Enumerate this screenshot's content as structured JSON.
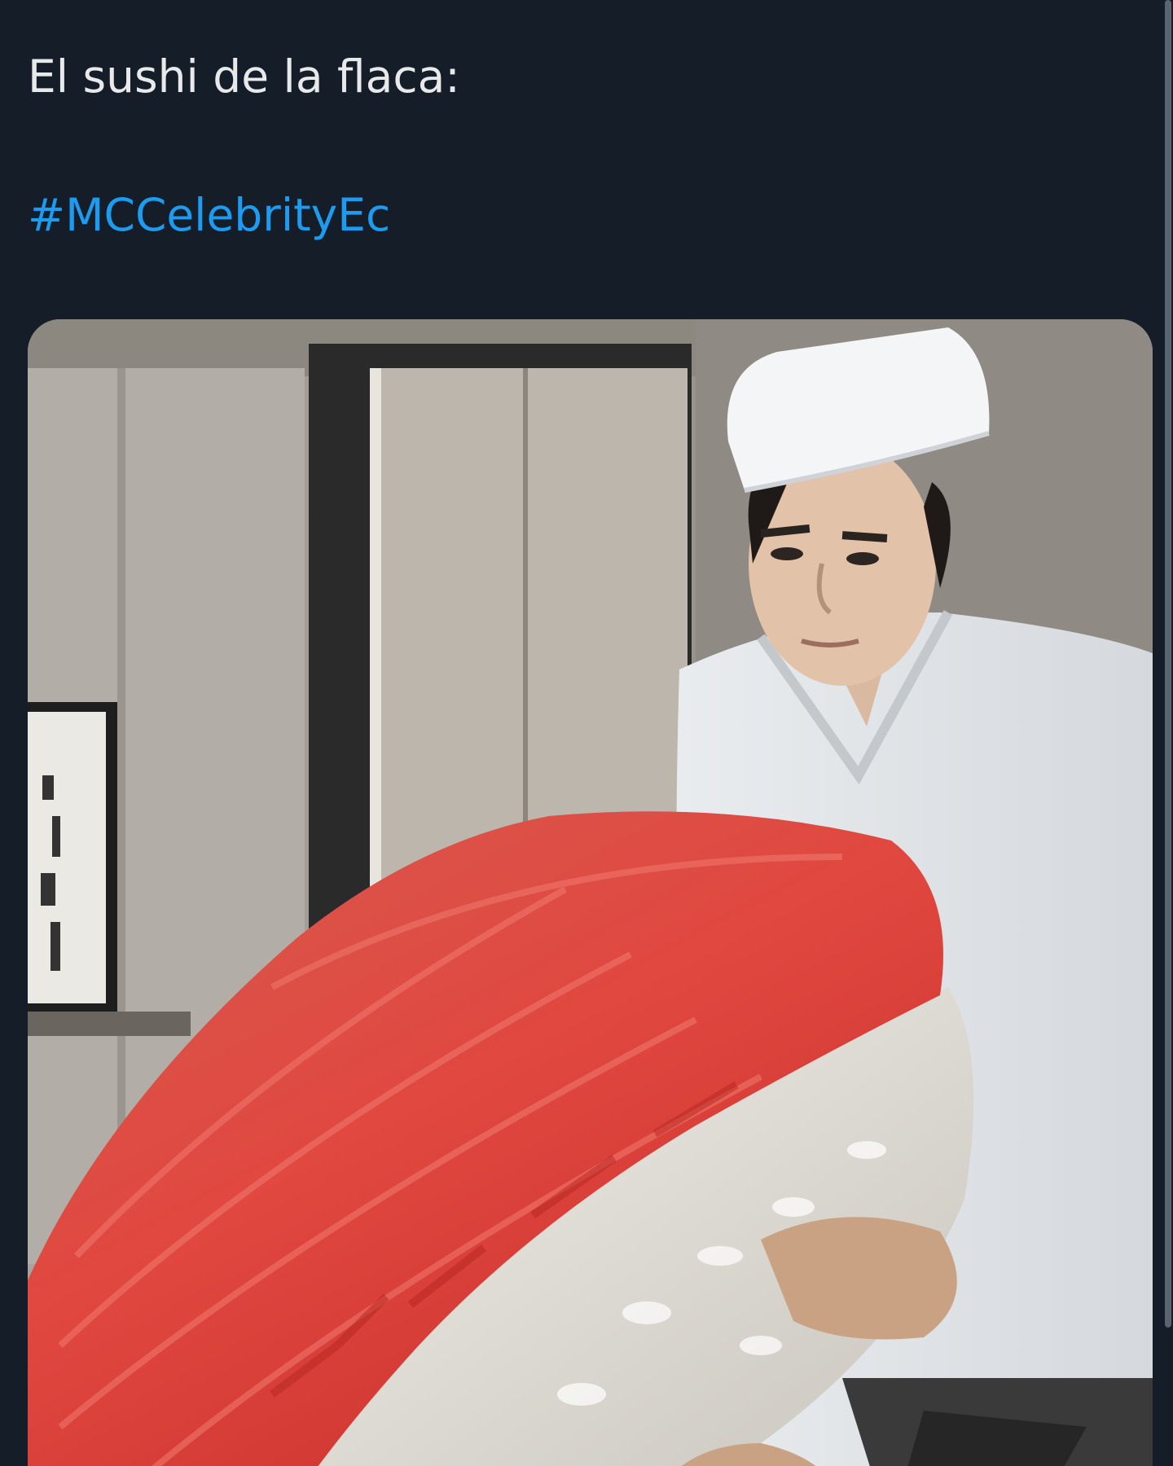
{
  "tweet": {
    "text": "El sushi de la flaca:",
    "hashtag": "#MCCelebrityEc"
  },
  "media": {
    "alt": "Sushi chef holding an enormous piece of tuna nigiri"
  },
  "colors": {
    "background": "#151d28",
    "text": "#e7e9ea",
    "link": "#1d9bf0"
  }
}
